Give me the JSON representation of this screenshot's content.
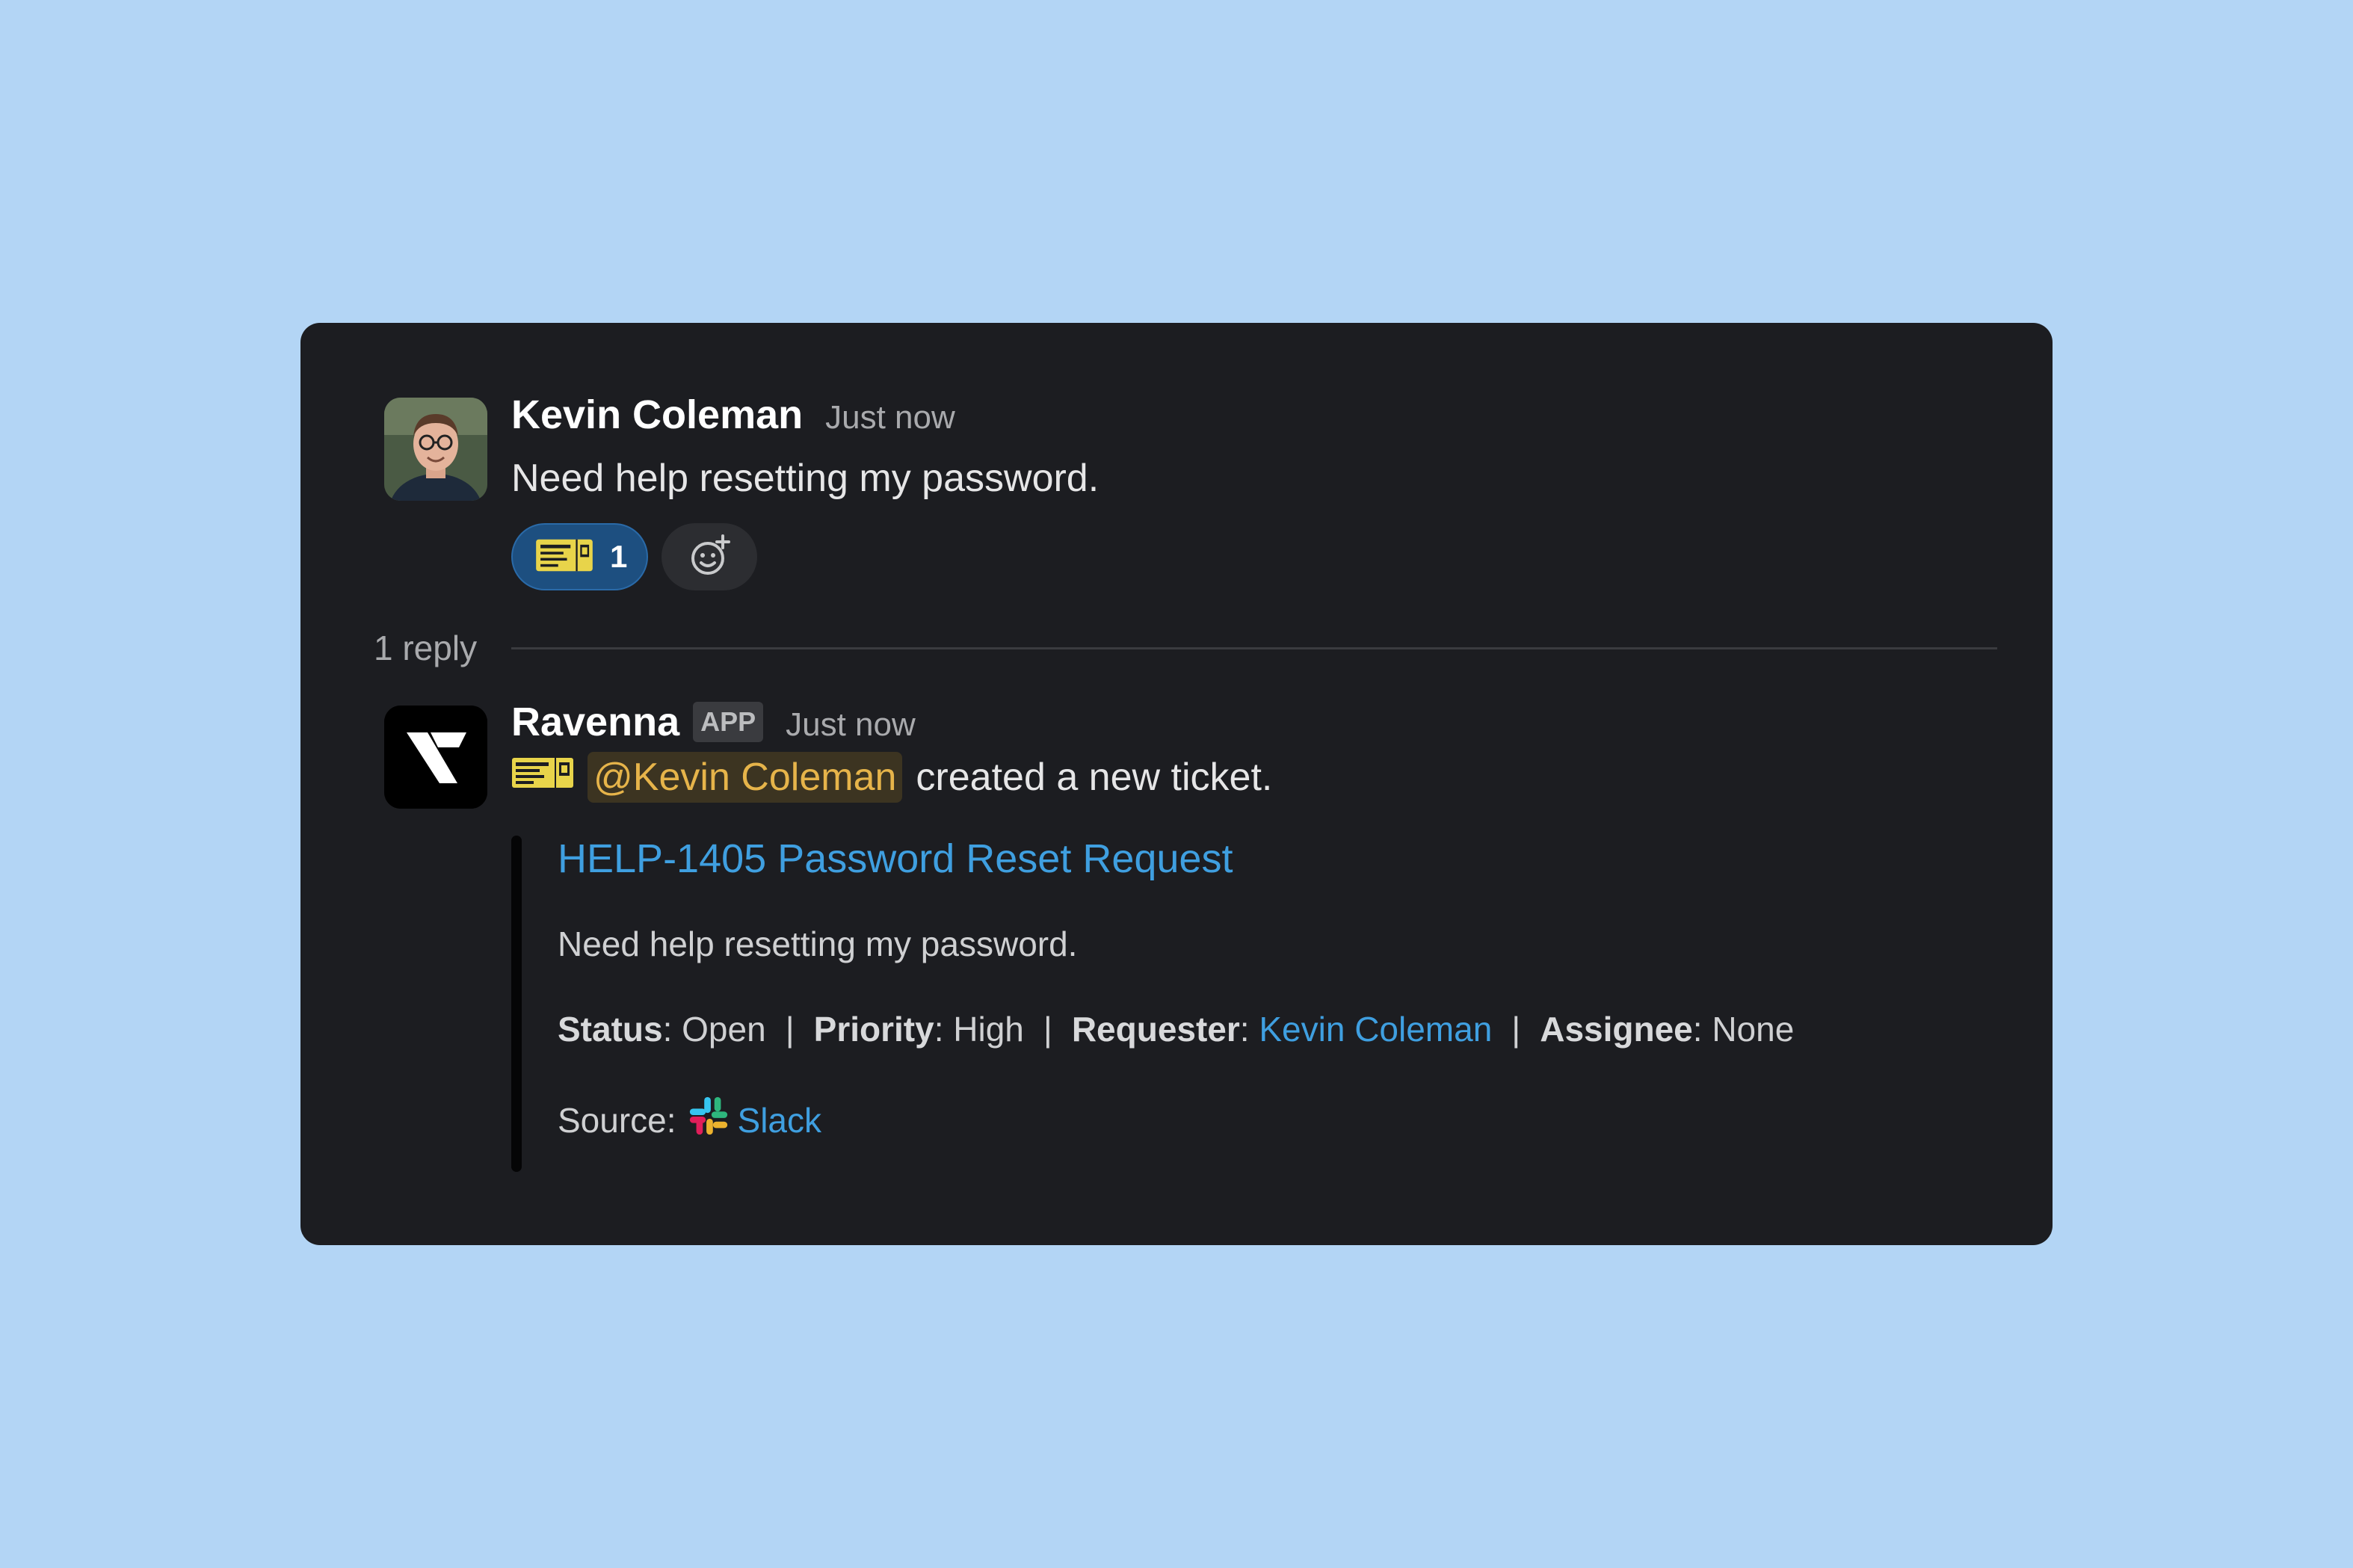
{
  "thread": {
    "message1": {
      "author": "Kevin Coleman",
      "timestamp": "Just now",
      "text": "Need help resetting my password.",
      "reaction": {
        "emoji": "ticket-emoji",
        "count": "1"
      },
      "add_reaction_icon": "add-reaction-icon"
    },
    "replies_label": "1 reply",
    "message2": {
      "author": "Ravenna",
      "badge": "APP",
      "timestamp": "Just now",
      "mention": "@Kevin Coleman",
      "text": "created a new ticket.",
      "attachment": {
        "title": "HELP-1405 Password Reset Request",
        "description": "Need help resetting my password.",
        "status_key": "Status",
        "status_value": "Open",
        "priority_key": "Priority",
        "priority_value": "High",
        "requester_key": "Requester",
        "requester_value": "Kevin Coleman",
        "assignee_key": "Assignee",
        "assignee_value": "None",
        "source_key": "Source:",
        "source_value": "Slack"
      }
    }
  },
  "colors": {
    "background": "#b3d5f5",
    "card": "#1c1d21",
    "link": "#3f9fe0",
    "mention": "#e6b44a",
    "reaction_pill": "#1d4f80"
  }
}
